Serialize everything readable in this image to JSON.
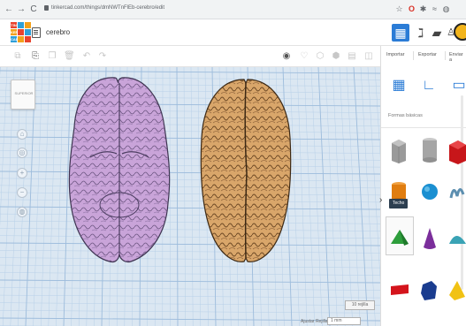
{
  "browser": {
    "url": "tinkercad.com/things/dmNWTnFlEb-cerebro/edit"
  },
  "logo": {
    "letters": [
      "TIN",
      "KER",
      "CAD"
    ]
  },
  "project": {
    "name": "cerebro"
  },
  "right_panel": {
    "tabs": {
      "import": "Importar",
      "export": "Exportar",
      "send": "Enviar a"
    },
    "category_label": "Formas básicas",
    "tooltip": "Techo"
  },
  "workplane": {
    "view_cube_label": "SUPERIOR",
    "snap_value": "10 rejilla",
    "snap_label": "Ajustar Rejilla",
    "snap_option": "1 mm"
  },
  "colors": {
    "accent": "#2b7cd6",
    "brain_left": "#c9a4d9",
    "brain_right": "#d9a66a",
    "grid": "#a9c4df"
  }
}
